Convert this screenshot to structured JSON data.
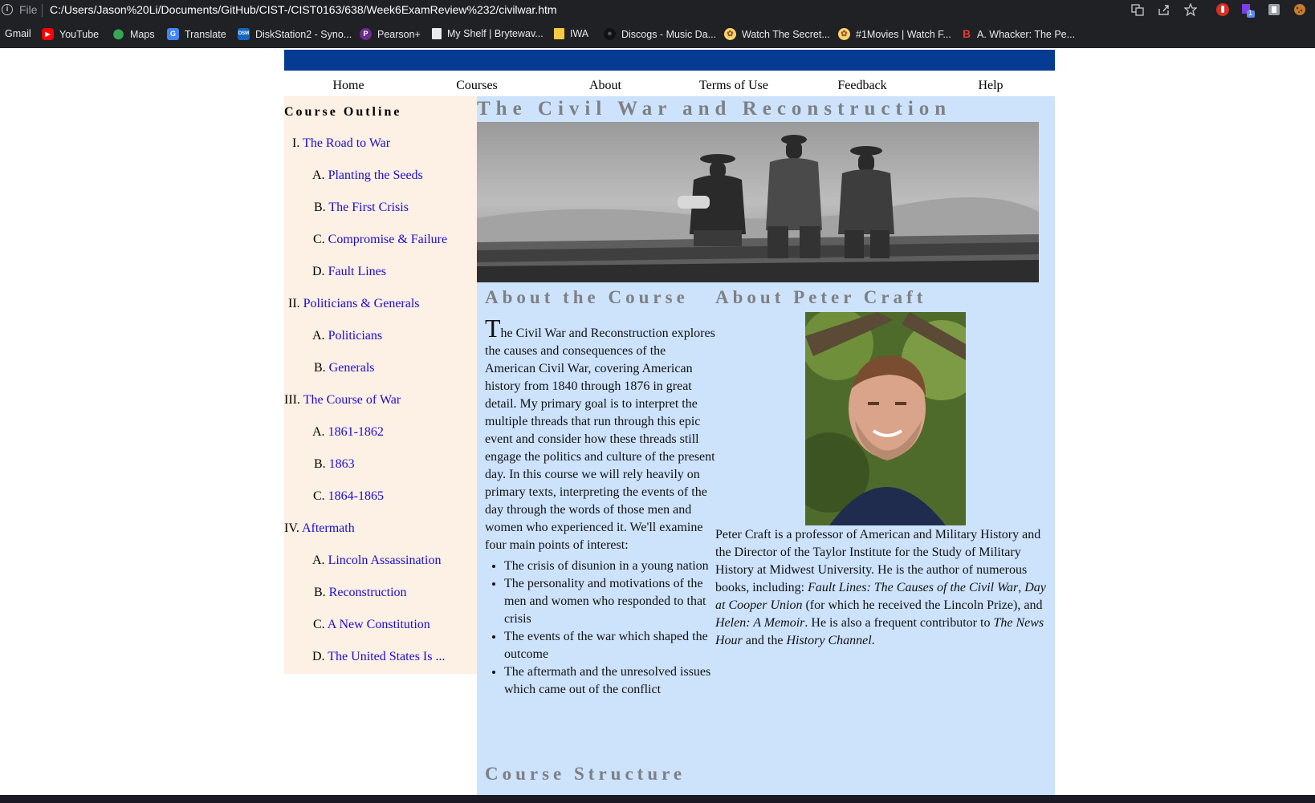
{
  "browser": {
    "file_label": "File",
    "url": "C:/Users/Jason%20Li/Documents/GitHub/CIST-/CIST0163/638/Week6ExamReview%232/civilwar.htm",
    "bookmarks": [
      {
        "label": "Gmail",
        "icon": "gmail-icon"
      },
      {
        "label": "YouTube",
        "icon": "youtube-icon"
      },
      {
        "label": "Maps",
        "icon": "maps-icon"
      },
      {
        "label": "Translate",
        "icon": "translate-icon"
      },
      {
        "label": "DiskStation2 - Syno...",
        "icon": "dsm-icon"
      },
      {
        "label": "Pearson+",
        "icon": "pearson-icon"
      },
      {
        "label": "My Shelf | Brytewav...",
        "icon": "document-icon"
      },
      {
        "label": "IWA",
        "icon": "folder-icon"
      },
      {
        "label": "Discogs - Music Da...",
        "icon": "discogs-icon"
      },
      {
        "label": "Watch The Secret...",
        "icon": "movie-icon"
      },
      {
        "label": "#1Movies | Watch F...",
        "icon": "movie-icon"
      },
      {
        "label": "A. Whacker: The Pe...",
        "icon": "b-icon"
      }
    ],
    "bookmark_icon_glyphs": {
      "maps_glyph": "⬤",
      "translate_glyph": "G",
      "dsm_glyph": "DSM",
      "pearson_glyph": "P",
      "discogs_glyph": "●",
      "movie_glyph": "✿",
      "b_glyph": "B"
    },
    "extension_badge": "1"
  },
  "nav": [
    "Home",
    "Courses",
    "About",
    "Terms of Use",
    "Feedback",
    "Help"
  ],
  "sidebar": {
    "title": "Course Outline",
    "items": [
      {
        "num": "I.",
        "label": "The Road to War"
      },
      {
        "num": "A.",
        "label": "Planting the Seeds"
      },
      {
        "num": "B.",
        "label": "The First Crisis"
      },
      {
        "num": "C.",
        "label": "Compromise & Failure"
      },
      {
        "num": "D.",
        "label": "Fault Lines"
      },
      {
        "num": "II.",
        "label": "Politicians & Generals"
      },
      {
        "num": "A.",
        "label": "Politicians"
      },
      {
        "num": "B.",
        "label": "Generals"
      },
      {
        "num": "III.",
        "label": "The Course of War"
      },
      {
        "num": "A.",
        "label": "1861-1862"
      },
      {
        "num": "B.",
        "label": "1863"
      },
      {
        "num": "C.",
        "label": "1864-1865"
      },
      {
        "num": "IV.",
        "label": "Aftermath"
      },
      {
        "num": "A.",
        "label": "Lincoln Assassination"
      },
      {
        "num": "B.",
        "label": "Reconstruction"
      },
      {
        "num": "C.",
        "label": "A New Constitution"
      },
      {
        "num": "D.",
        "label": "The United States Is ..."
      }
    ]
  },
  "main": {
    "title": "The Civil War and Reconstruction",
    "about_course": {
      "heading": "About the Course",
      "dropcap": "T",
      "intro_rest": "he Civil War and Reconstruction explores the causes and consequences of the American Civil War, covering American history from 1840 through 1876 in great detail. My primary goal is to interpret the multiple threads that run through this epic event and consider how these threads still engage the politics and culture of the present day. In this course we will rely heavily on primary texts, interpreting the events of the day through the words of those men and women who experienced it. We'll examine four main points of interest:",
      "points": [
        "The crisis of disunion in a young nation",
        "The personality and motivations of the men and women who responded to that crisis",
        "The events of the war which shaped the outcome",
        "The aftermath and the unresolved issues which came out of the conflict"
      ]
    },
    "about_craft": {
      "heading": "About Peter Craft",
      "bio_1": "Peter Craft is a professor of American and Military History and the Director of the Taylor Institute for the Study of Military History at Midwest University. He is the author of numerous books, including: ",
      "book_1": "Fault Lines: The Causes of the Civil War",
      "sep_1": ", ",
      "book_2": "Day at Cooper Union",
      "bio_2": " (for which he received the Lincoln Prize), and ",
      "book_3": "Helen: A Memoir",
      "bio_3": ". He is also a frequent contributor to ",
      "show_1": "The News Hour",
      "bio_4": " and the ",
      "show_2": "History Channel",
      "bio_5": "."
    },
    "structure_heading": "Course Structure"
  }
}
